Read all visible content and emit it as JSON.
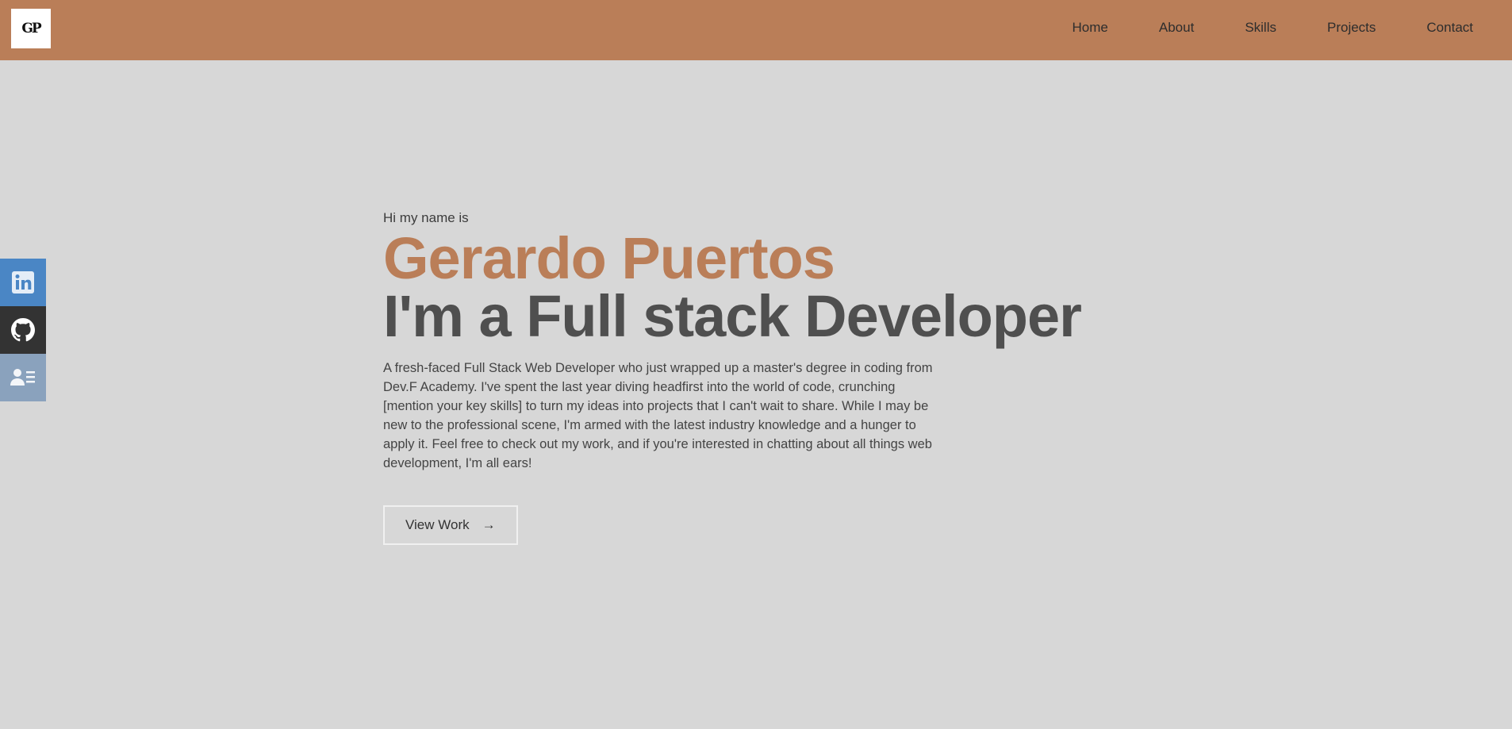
{
  "nav": {
    "logo_text": "GP",
    "links": [
      "Home",
      "About",
      "Skills",
      "Projects",
      "Contact"
    ]
  },
  "social": [
    {
      "name": "LinkedIn",
      "icon": "linkedin-icon",
      "color": "#4a86c5"
    },
    {
      "name": "GitHub",
      "icon": "github-icon",
      "color": "#333333"
    },
    {
      "name": "Resume",
      "icon": "contact-card-icon",
      "color": "#8aa2bd"
    }
  ],
  "hero": {
    "greeting": "Hi my name is",
    "name": "Gerardo Puertos",
    "role": "I'm a Full stack Developer",
    "bio": "A fresh-faced Full Stack Web Developer who just wrapped up a master's degree in coding from Dev.F Academy. I've spent the last year diving headfirst into the world of code, crunching [mention your key skills] to turn my ideas into projects that I can't wait to share. While I may be new to the professional scene, I'm armed with the latest industry knowledge and a hunger to apply it. Feel free to check out my work, and if you're interested in chatting about all things web development, I'm all ears!",
    "cta_label": "View Work",
    "cta_icon": "arrow-right-icon"
  },
  "colors": {
    "accent": "#ba7e58",
    "background": "#d7d7d7",
    "heading": "#4f4f4f"
  }
}
